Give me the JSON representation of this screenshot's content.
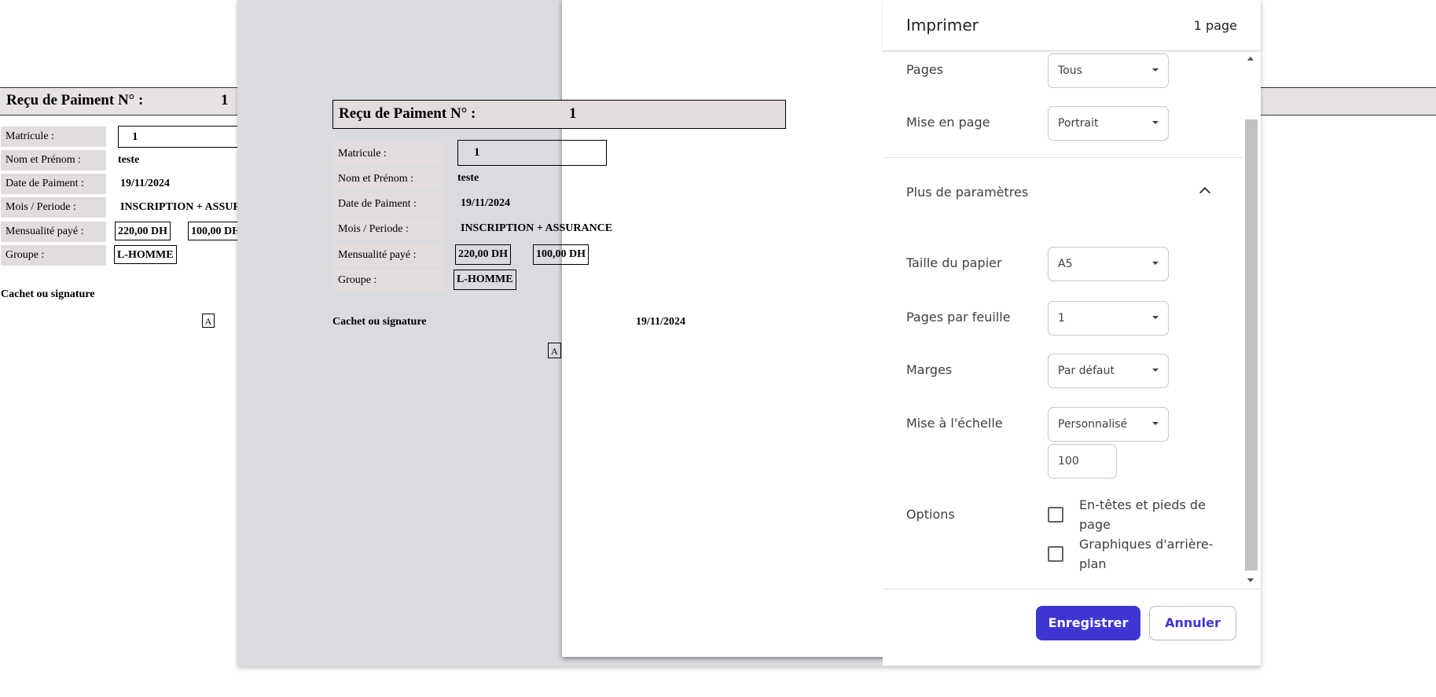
{
  "receipt": {
    "title": "Reçu de Paiment N° :",
    "number": "1",
    "fields": [
      {
        "label": "Matricule :",
        "value": "1"
      },
      {
        "label": "Nom et Prénom :",
        "value": "teste"
      },
      {
        "label": "Date de Paiment :",
        "value": "19/11/2024"
      },
      {
        "label": "Mois / Periode :",
        "value": "INSCRIPTION + ASSURANCE"
      },
      {
        "label": "Mensualité payé :",
        "value": "220,00 DH",
        "value2": "100,00 DH"
      },
      {
        "label": "Groupe :",
        "value": "L-HOMME"
      }
    ],
    "signature_label": "Cachet ou signature",
    "signature_date": "19/11/2024",
    "stamp": "A"
  },
  "background": {
    "mois_visible": "INSCRIPTION + ASSUR",
    "mensualite2_visible": "100,00 DH"
  },
  "print_dialog": {
    "title": "Imprimer",
    "page_count": "1 page",
    "settings": {
      "pages": {
        "label": "Pages",
        "value": "Tous"
      },
      "layout": {
        "label": "Mise en page",
        "value": "Portrait"
      },
      "more_settings": "Plus de paramètres",
      "paper_size": {
        "label": "Taille du papier",
        "value": "A5"
      },
      "pages_per_sheet": {
        "label": "Pages par feuille",
        "value": "1"
      },
      "margins": {
        "label": "Marges",
        "value": "Par défaut"
      },
      "scale": {
        "label": "Mise à l'échelle",
        "value": "Personnalisé",
        "custom_value": "100"
      },
      "options": {
        "label": "Options",
        "headers_footers": "En-têtes et pieds de page",
        "background_graphics": "Graphiques d'arrière-plan"
      }
    },
    "buttons": {
      "save": "Enregistrer",
      "cancel": "Annuler"
    }
  },
  "colors": {
    "accent": "#3f36d2",
    "label_bg": "#e3dcdc",
    "overlay": "#dadbdf"
  }
}
